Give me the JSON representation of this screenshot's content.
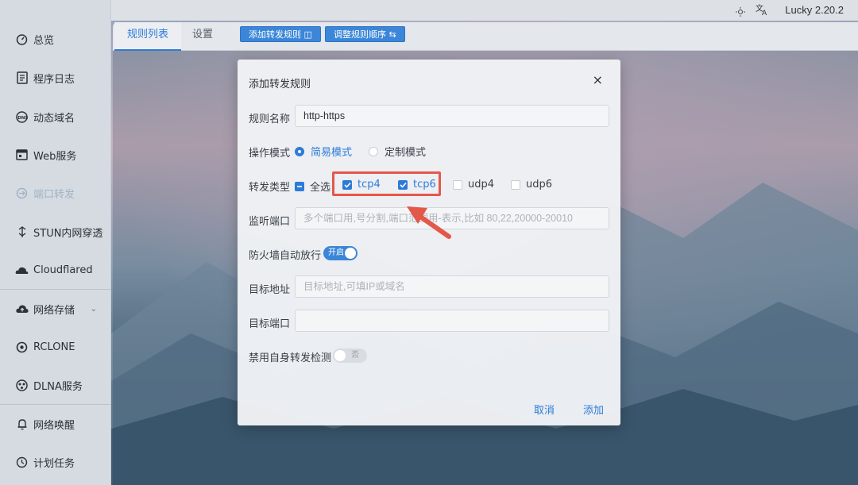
{
  "app": {
    "version": "Lucky 2.20.2"
  },
  "sidebar": {
    "items": [
      {
        "label": "总览"
      },
      {
        "label": "程序日志"
      },
      {
        "label": "动态域名"
      },
      {
        "label": "Web服务"
      },
      {
        "label": "端口转发"
      },
      {
        "label": "STUN内网穿透"
      },
      {
        "label": "Cloudflared"
      },
      {
        "label": "网络存储"
      },
      {
        "label": "RCLONE"
      },
      {
        "label": "DLNA服务"
      },
      {
        "label": "网络唤醒"
      },
      {
        "label": "计划任务"
      }
    ]
  },
  "tabs": [
    {
      "label": "规则列表"
    },
    {
      "label": "设置"
    }
  ],
  "toolbar": {
    "add_rule": "添加转发规则",
    "reorder": "调整规则顺序"
  },
  "dialog": {
    "title": "添加转发规则",
    "rule_name": {
      "label": "规则名称",
      "value": "http-https"
    },
    "mode": {
      "label": "操作模式",
      "options": [
        {
          "label": "简易模式",
          "selected": true
        },
        {
          "label": "定制模式",
          "selected": false
        }
      ]
    },
    "forward_type": {
      "label": "转发类型",
      "select_all": "全选",
      "options": [
        {
          "label": "tcp4",
          "checked": true
        },
        {
          "label": "tcp6",
          "checked": true
        },
        {
          "label": "udp4",
          "checked": false
        },
        {
          "label": "udp6",
          "checked": false
        }
      ]
    },
    "listen_port": {
      "label": "监听端口",
      "placeholder": "多个端口用,号分割,端口范围用-表示,比如 80,22,20000-20010"
    },
    "firewall": {
      "label": "防火墙自动放行",
      "state": "开启"
    },
    "target_addr": {
      "label": "目标地址",
      "placeholder": "目标地址,可填IP或域名"
    },
    "target_port": {
      "label": "目标端口",
      "placeholder": ""
    },
    "disable_self_check": {
      "label": "禁用自身转发检测",
      "state": "否"
    },
    "cancel": "取消",
    "submit": "添加"
  },
  "colors": {
    "accent": "#2d7bd8",
    "highlight": "#e4584a"
  }
}
